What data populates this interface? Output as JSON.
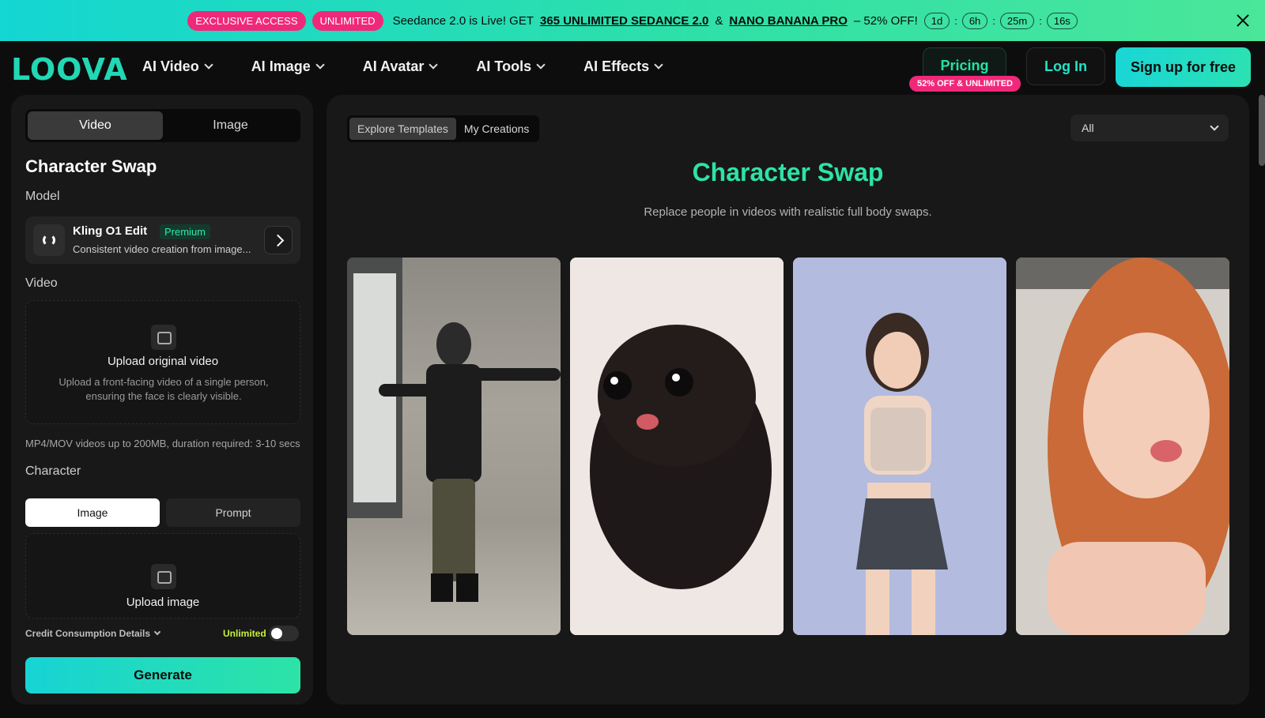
{
  "banner": {
    "badge1": "EXCLUSIVE ACCESS",
    "badge2": "UNLIMITED",
    "msg_prefix": "Seedance 2.0 is Live! GET",
    "link1": "365 UNLIMITED SEDANCE 2.0",
    "amp": "&",
    "link2": "NANO BANANA PRO",
    "msg_suffix": "– 52% OFF!",
    "timer": {
      "days": "1d",
      "hours": "6h",
      "minutes": "25m",
      "seconds": "16s"
    },
    "sep": ":"
  },
  "nav": {
    "logo": "LOOVA",
    "menu": [
      {
        "label": "AI Video"
      },
      {
        "label": "AI Image"
      },
      {
        "label": "AI Avatar"
      },
      {
        "label": "AI Tools"
      },
      {
        "label": "AI Effects"
      }
    ],
    "pricing": "Pricing",
    "pricing_badge": "52% OFF & UNLIMITED",
    "login": "Log In",
    "signup": "Sign up for free"
  },
  "left": {
    "mode_tabs": [
      "Video",
      "Image"
    ],
    "title": "Character Swap",
    "model_label": "Model",
    "model": {
      "name": "Kling O1 Edit",
      "tag": "Premium",
      "desc": "Consistent video creation from image..."
    },
    "video_label": "Video",
    "video_upload": {
      "title": "Upload original video",
      "desc": "Upload a front-facing video of a single person, ensuring the face is clearly visible."
    },
    "video_note": "MP4/MOV videos up to 200MB, duration required: 3-10 secs",
    "character_label": "Character",
    "character_tabs": [
      "Image",
      "Prompt"
    ],
    "image_upload": {
      "title": "Upload image"
    },
    "credit_label": "Credit Consumption Details",
    "unlimited_label": "Unlimited",
    "generate": "Generate"
  },
  "right": {
    "tabs": [
      "Explore Templates",
      "My Creations"
    ],
    "filter": "All",
    "title": "Character Swap",
    "subtitle": "Replace people in videos with realistic full body swaps."
  }
}
